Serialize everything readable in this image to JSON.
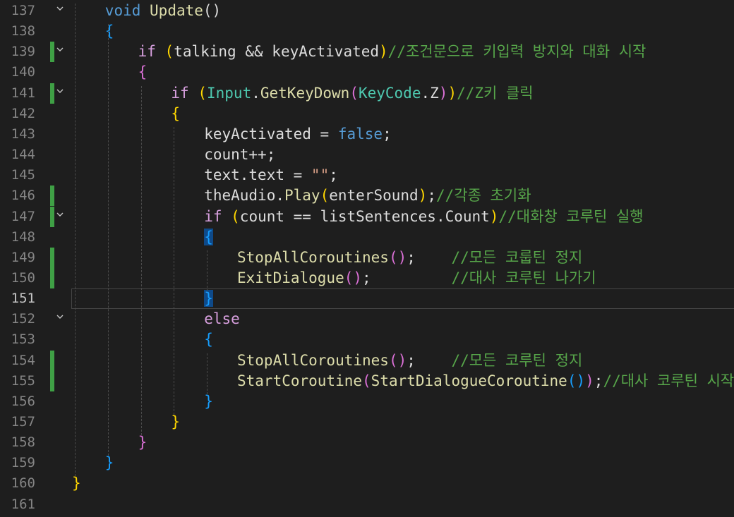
{
  "editor": {
    "active_line": 151,
    "lines": [
      {
        "n": "137",
        "indent": 2,
        "fold": true,
        "changed": false,
        "tokens": [
          [
            "void",
            "kw"
          ],
          [
            " ",
            ""
          ],
          [
            "Update",
            "fn"
          ],
          [
            "()",
            "id"
          ]
        ]
      },
      {
        "n": "138",
        "indent": 2,
        "fold": false,
        "changed": false,
        "tokens": [
          [
            "{",
            "br3"
          ]
        ]
      },
      {
        "n": "139",
        "indent": 3,
        "fold": true,
        "changed": true,
        "tokens": [
          [
            "if",
            "ctl"
          ],
          [
            " ",
            ""
          ],
          [
            "(",
            "br1"
          ],
          [
            "talking",
            "id"
          ],
          [
            " && ",
            "id"
          ],
          [
            "keyActivated",
            "id"
          ],
          [
            ")",
            "br1"
          ],
          [
            "//조건문으로 키입력 방지와 대화 시작",
            "cm"
          ]
        ]
      },
      {
        "n": "140",
        "indent": 3,
        "fold": false,
        "changed": false,
        "tokens": [
          [
            "{",
            "br2"
          ]
        ]
      },
      {
        "n": "141",
        "indent": 4,
        "fold": true,
        "changed": true,
        "tokens": [
          [
            "if",
            "ctl"
          ],
          [
            " ",
            ""
          ],
          [
            "(",
            "br1"
          ],
          [
            "Input",
            "cls"
          ],
          [
            ".",
            "id"
          ],
          [
            "GetKeyDown",
            "fn"
          ],
          [
            "(",
            "br2"
          ],
          [
            "KeyCode",
            "cls"
          ],
          [
            ".Z",
            "id"
          ],
          [
            ")",
            "br2"
          ],
          [
            ")",
            "br1"
          ],
          [
            "//Z키 클릭",
            "cm"
          ]
        ]
      },
      {
        "n": "142",
        "indent": 4,
        "fold": false,
        "changed": false,
        "tokens": [
          [
            "{",
            "br1"
          ]
        ]
      },
      {
        "n": "143",
        "indent": 5,
        "fold": false,
        "changed": false,
        "tokens": [
          [
            "keyActivated",
            "id"
          ],
          [
            " = ",
            "id"
          ],
          [
            "false",
            "kw"
          ],
          [
            ";",
            "id"
          ]
        ]
      },
      {
        "n": "144",
        "indent": 5,
        "fold": false,
        "changed": false,
        "tokens": [
          [
            "count",
            "id"
          ],
          [
            "++;",
            "id"
          ]
        ]
      },
      {
        "n": "145",
        "indent": 5,
        "fold": false,
        "changed": false,
        "tokens": [
          [
            "text",
            "id"
          ],
          [
            ".text = ",
            "id"
          ],
          [
            "\"\"",
            "str"
          ],
          [
            ";",
            "id"
          ]
        ]
      },
      {
        "n": "146",
        "indent": 5,
        "fold": false,
        "changed": true,
        "tokens": [
          [
            "theAudio",
            "id"
          ],
          [
            ".",
            "id"
          ],
          [
            "Play",
            "fn"
          ],
          [
            "(",
            "br1"
          ],
          [
            "enterSound",
            "id"
          ],
          [
            ")",
            "br1"
          ],
          [
            ";",
            "id"
          ],
          [
            "//각종 초기화",
            "cm"
          ]
        ]
      },
      {
        "n": "147",
        "indent": 5,
        "fold": true,
        "changed": true,
        "tokens": [
          [
            "if",
            "ctl"
          ],
          [
            " ",
            ""
          ],
          [
            "(",
            "br1"
          ],
          [
            "count == listSentences",
            "id"
          ],
          [
            ".",
            "id"
          ],
          [
            "Count",
            "id"
          ],
          [
            ")",
            "br1"
          ],
          [
            "//대화창 코루틴 실행",
            "cm"
          ]
        ]
      },
      {
        "n": "148",
        "indent": 5,
        "fold": false,
        "changed": false,
        "tokens": [
          [
            "{",
            "br3 br-hl"
          ]
        ]
      },
      {
        "n": "149",
        "indent": 6,
        "fold": false,
        "changed": true,
        "tokens": [
          [
            "StopAllCoroutines",
            "fn"
          ],
          [
            "()",
            "br2"
          ],
          [
            ";    ",
            "id"
          ],
          [
            "//모든 코룹틴 정지",
            "cm"
          ]
        ]
      },
      {
        "n": "150",
        "indent": 6,
        "fold": false,
        "changed": true,
        "tokens": [
          [
            "ExitDialogue",
            "fn"
          ],
          [
            "()",
            "br2"
          ],
          [
            ";         ",
            "id"
          ],
          [
            "//대사 코루틴 나가기",
            "cm"
          ]
        ]
      },
      {
        "n": "151",
        "indent": 5,
        "fold": false,
        "changed": false,
        "tokens": [
          [
            "}",
            "br3 br-hl"
          ]
        ]
      },
      {
        "n": "152",
        "indent": 5,
        "fold": true,
        "changed": false,
        "tokens": [
          [
            "else",
            "ctl"
          ]
        ]
      },
      {
        "n": "153",
        "indent": 5,
        "fold": false,
        "changed": false,
        "tokens": [
          [
            "{",
            "br3"
          ]
        ]
      },
      {
        "n": "154",
        "indent": 6,
        "fold": false,
        "changed": true,
        "tokens": [
          [
            "StopAllCoroutines",
            "fn"
          ],
          [
            "()",
            "br2"
          ],
          [
            ";    ",
            "id"
          ],
          [
            "//모든 코루틴 정지",
            "cm"
          ]
        ]
      },
      {
        "n": "155",
        "indent": 6,
        "fold": false,
        "changed": true,
        "tokens": [
          [
            "StartCoroutine",
            "fn"
          ],
          [
            "(",
            "br2"
          ],
          [
            "StartDialogueCoroutine",
            "fn"
          ],
          [
            "()",
            "br3"
          ],
          [
            ")",
            "br2"
          ],
          [
            ";",
            "id"
          ],
          [
            "//대사 코루틴 시작",
            "cm"
          ]
        ]
      },
      {
        "n": "156",
        "indent": 5,
        "fold": false,
        "changed": false,
        "tokens": [
          [
            "}",
            "br3"
          ]
        ]
      },
      {
        "n": "157",
        "indent": 4,
        "fold": false,
        "changed": false,
        "tokens": [
          [
            "}",
            "br1"
          ]
        ]
      },
      {
        "n": "158",
        "indent": 3,
        "fold": false,
        "changed": false,
        "tokens": [
          [
            "}",
            "br2"
          ]
        ]
      },
      {
        "n": "159",
        "indent": 2,
        "fold": false,
        "changed": false,
        "tokens": [
          [
            "}",
            "br3"
          ]
        ]
      },
      {
        "n": "160",
        "indent": 1,
        "fold": false,
        "changed": false,
        "tokens": [
          [
            "}",
            "br1"
          ]
        ]
      },
      {
        "n": "161",
        "indent": 0,
        "fold": false,
        "changed": false,
        "tokens": []
      }
    ]
  },
  "icons": {
    "fold": "chevron-down-icon"
  },
  "colors": {
    "background": "#1e1e1e",
    "changed_marker": "#3fa045",
    "keyword": "#569cd6",
    "control": "#d8a0df",
    "function": "#dcdcaa",
    "type": "#4ec9b0",
    "string": "#d69d85",
    "comment": "#57a64a"
  }
}
